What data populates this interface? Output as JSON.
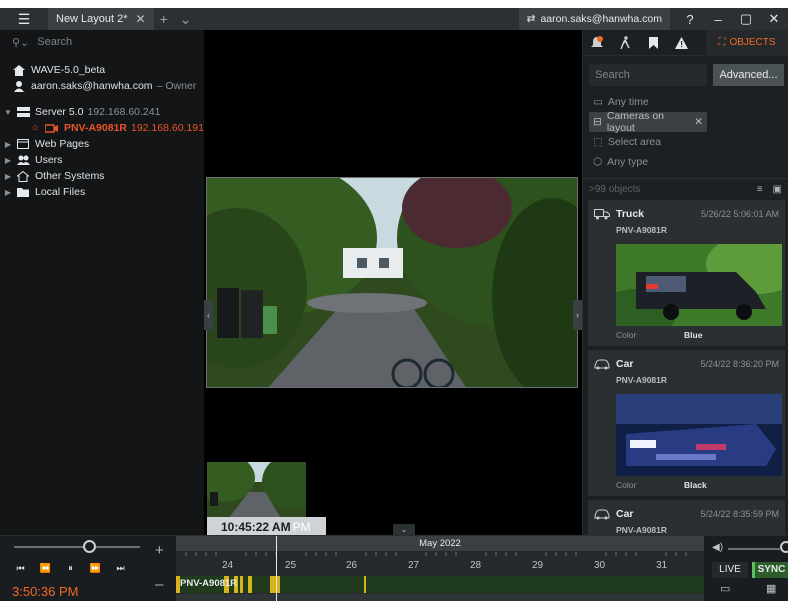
{
  "titlebar": {
    "tab_label": "New Layout 2*",
    "user": "aaron.saks@hanwha.com",
    "help": "?",
    "minimize": "–",
    "maximize": "▢",
    "close": "✕"
  },
  "left": {
    "search_placeholder": "Search",
    "system_name": "WAVE-5.0_beta",
    "user_name": "aaron.saks@hanwha.com",
    "user_role": "– Owner",
    "server_name": "Server 5.0",
    "server_ip": "192.168.60.241",
    "camera_name": "PNV-A9081R",
    "camera_ip": "192.168.60.191",
    "web_pages": "Web Pages",
    "users": "Users",
    "other_systems": "Other Systems",
    "local_files": "Local Files"
  },
  "view": {
    "time_chip": "10:45:22 AM",
    "time_chip_suffix": "PM"
  },
  "right": {
    "objects_tab": "OBJECTS",
    "search_placeholder": "Search",
    "advanced_label": "Advanced...",
    "filter_time": "Any time",
    "filter_cameras": "Cameras on layout",
    "filter_area": "Select area",
    "filter_type": "Any type",
    "results_count": ">99 objects",
    "cards": [
      {
        "type": "Truck",
        "timestamp": "5/26/22 5:06:01 AM",
        "camera": "PNV-A9081R",
        "attr_label": "Color",
        "attr_value": "Blue"
      },
      {
        "type": "Car",
        "timestamp": "5/24/22 8:36:20 PM",
        "camera": "PNV-A9081R",
        "attr_label": "Color",
        "attr_value": "Black"
      },
      {
        "type": "Car",
        "timestamp": "5/24/22 8:35:59 PM",
        "camera": "PNV-A9081R"
      }
    ]
  },
  "timeline": {
    "current_time": "3:50:36 PM",
    "month": "May 2022",
    "days": [
      "24",
      "25",
      "26",
      "27",
      "28",
      "29",
      "30",
      "31"
    ],
    "track_camera": "PNV-A9081R",
    "live_label": "LIVE",
    "sync_label": "SYNC"
  },
  "colors": {
    "accent": "#f06a26",
    "sync": "#2e5d2b",
    "recording": "#1f3a1d",
    "motion": "#d8b41c"
  }
}
